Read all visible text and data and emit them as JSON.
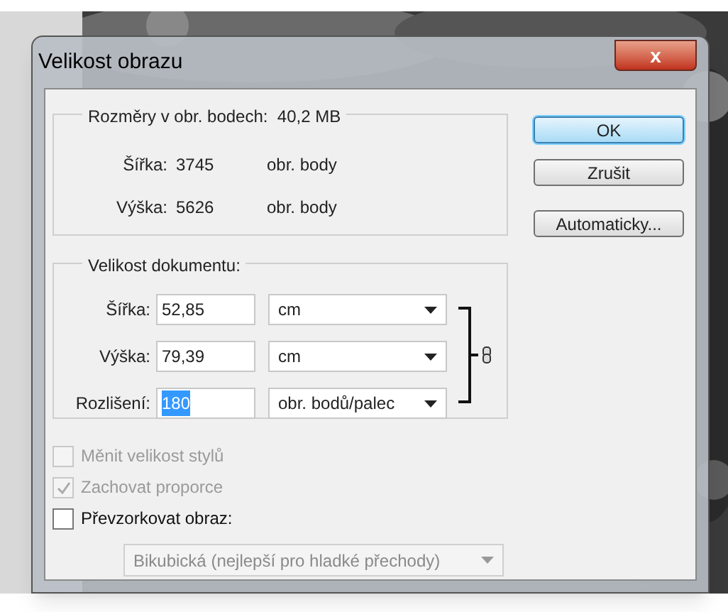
{
  "window": {
    "title": "Velikost obrazu",
    "close": "x"
  },
  "pixel_dimensions": {
    "legend": "Rozměry v obr. bodech:  40,2 MB",
    "rows": [
      {
        "label": "Šířka:",
        "value": "3745",
        "unit": "obr. body"
      },
      {
        "label": "Výška:",
        "value": "5626",
        "unit": "obr. body"
      }
    ]
  },
  "document_size": {
    "legend": "Velikost dokumentu:",
    "rows": [
      {
        "label": "Šířka:",
        "value": "52,85",
        "unit": "cm",
        "highlighted": false
      },
      {
        "label": "Výška:",
        "value": "79,39",
        "unit": "cm",
        "highlighted": false
      },
      {
        "label": "Rozlišení:",
        "value": "180",
        "unit": "obr. bodů/palec",
        "highlighted": true
      }
    ]
  },
  "options": [
    {
      "label": "Měnit velikost stylů",
      "checked": false,
      "disabled": true
    },
    {
      "label": "Zachovat proporce",
      "checked": true,
      "disabled": true
    },
    {
      "label": "Převzorkovat obraz:",
      "checked": false,
      "disabled": false
    }
  ],
  "resample": {
    "value": "Bikubická (nejlepší pro hladké přechody)",
    "disabled": true
  },
  "buttons": [
    {
      "label": "OK",
      "default": true
    },
    {
      "label": "Zrušit",
      "default": false
    },
    {
      "label": "Automaticky...",
      "default": false
    }
  ]
}
